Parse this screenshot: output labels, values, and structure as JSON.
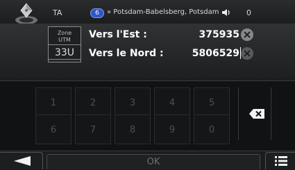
{
  "status_bar": {
    "label_ta": "TA",
    "route_number": "6",
    "road_name": "» Potsdam-Babelsberg, Potsdam-Ze...",
    "speaker_icon": "speaker-icon",
    "counter": "0"
  },
  "zone": {
    "label_line1": "Zone",
    "label_line2": "UTM",
    "value": "33U"
  },
  "coordinates": {
    "east_label": "Vers l'Est :",
    "east_value": "375935",
    "north_label": "Vers le Nord :",
    "north_value": "5806529",
    "clear_icon": "clear-circle-icon"
  },
  "keypad": {
    "keys": [
      "1",
      "2",
      "3",
      "4",
      "5",
      "6",
      "7",
      "8",
      "9",
      "0"
    ],
    "backspace_icon": "backspace-icon"
  },
  "bottom": {
    "back_icon": "back-arrow-icon",
    "ok_label": "OK",
    "menu_icon": "menu-icon"
  },
  "colors": {
    "route_badge": "#3057c8",
    "background": "#161719",
    "disabled_text": "#4e4f53"
  }
}
